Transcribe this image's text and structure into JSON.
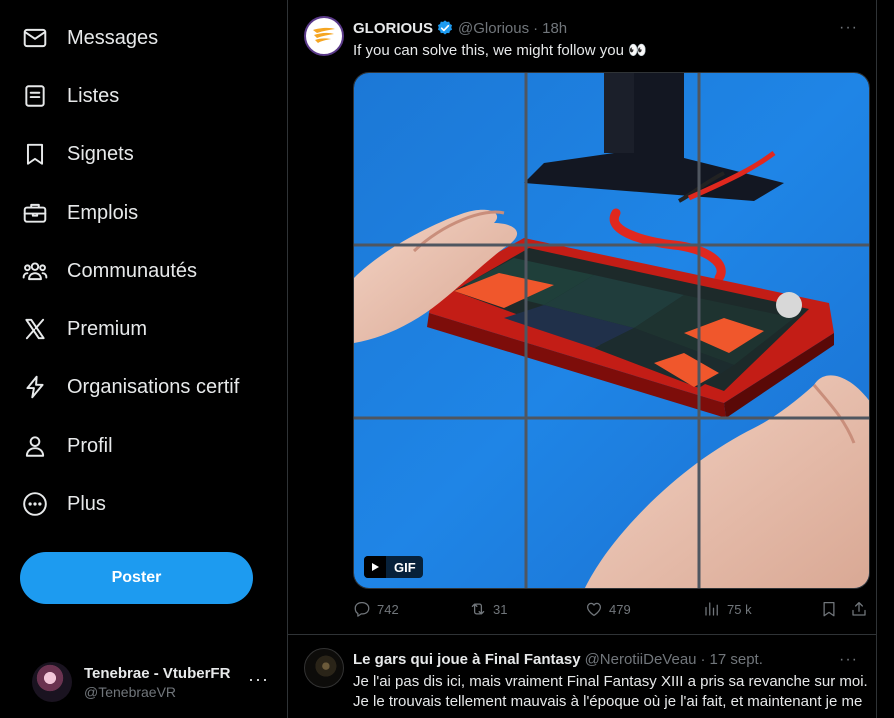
{
  "sidebar": {
    "items": [
      {
        "label": "Messages",
        "icon": "mail-icon"
      },
      {
        "label": "Listes",
        "icon": "list-icon"
      },
      {
        "label": "Signets",
        "icon": "bookmark-icon"
      },
      {
        "label": "Emplois",
        "icon": "briefcase-icon"
      },
      {
        "label": "Communautés",
        "icon": "communities-icon"
      },
      {
        "label": "Premium",
        "icon": "x-logo-icon"
      },
      {
        "label": "Organisations certif",
        "icon": "lightning-icon"
      },
      {
        "label": "Profil",
        "icon": "person-icon"
      },
      {
        "label": "Plus",
        "icon": "more-circle-icon"
      }
    ],
    "post_label": "Poster",
    "account": {
      "name": "Tenebrae - VtuberFR",
      "handle": "@TenebraeVR",
      "more": "···"
    }
  },
  "tweets": [
    {
      "name": "GLORIOUS",
      "handle": "@Glorious",
      "sep": "·",
      "time": "18h",
      "text": "If you can solve this, we might follow you 👀",
      "more": "···",
      "media_badge": "GIF",
      "stats": {
        "replies": "742",
        "reposts": "31",
        "likes": "479",
        "views": "75 k"
      }
    },
    {
      "name": "Le gars qui joue à Final Fantasy",
      "handle": "@NerotiiDeVeau",
      "sep": "·",
      "time": "17 sept.",
      "text": "Je l'ai pas dis ici, mais vraiment Final Fantasy XIII a pris sa revanche sur moi. Je le trouvais tellement mauvais à l'époque où je l'ai fait, et maintenant je me",
      "more": "···"
    }
  ],
  "colors": {
    "accent": "#1d9bf0",
    "background": "#000000",
    "muted": "#71767b",
    "border": "#2f3336"
  }
}
